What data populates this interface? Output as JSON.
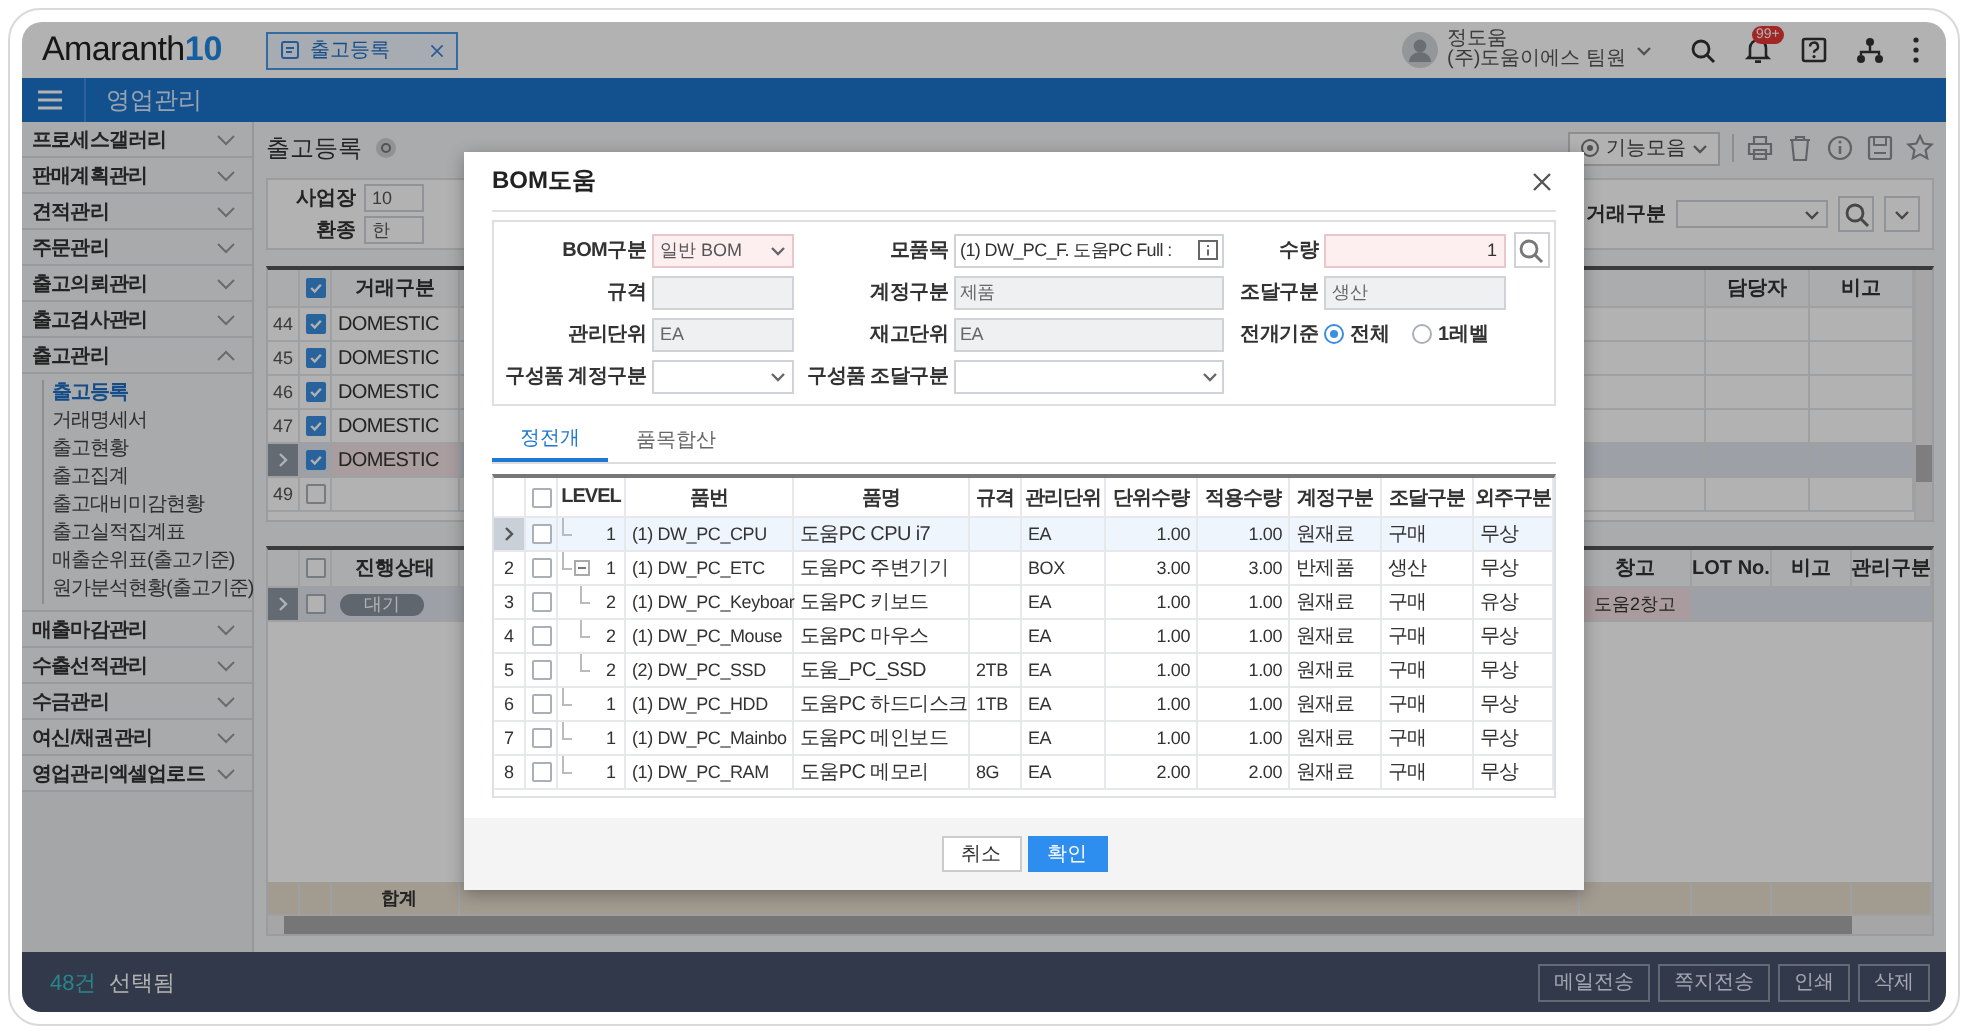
{
  "header": {
    "logo": "Amaranth",
    "logo_version": "10",
    "open_tab": {
      "label": "출고등록",
      "selected": true
    },
    "user": {
      "name": "정도움",
      "org": "(주)도움이에스 팀원"
    },
    "notification_badge": "99+"
  },
  "menu_bar": {
    "title": "영업관리"
  },
  "sidebar": {
    "items": [
      {
        "label": "프로세스갤러리",
        "expanded": false
      },
      {
        "label": "판매계획관리",
        "expanded": false
      },
      {
        "label": "견적관리",
        "expanded": false
      },
      {
        "label": "주문관리",
        "expanded": false
      },
      {
        "label": "출고의뢰관리",
        "expanded": false
      },
      {
        "label": "출고검사관리",
        "expanded": false
      },
      {
        "label": "출고관리",
        "expanded": true,
        "children": [
          {
            "label": "출고등록",
            "selected": true
          },
          {
            "label": "거래명세서",
            "selected": false
          },
          {
            "label": "출고현황",
            "selected": false
          },
          {
            "label": "출고집계",
            "selected": false
          },
          {
            "label": "출고대비미감현황",
            "selected": false
          },
          {
            "label": "출고실적집계표",
            "selected": false
          },
          {
            "label": "매출순위표(출고기준)",
            "selected": false
          },
          {
            "label": "원가분석현황(출고기준)",
            "selected": false
          }
        ]
      },
      {
        "label": "매출마감관리",
        "expanded": false
      },
      {
        "label": "수출선적관리",
        "expanded": false
      },
      {
        "label": "수금관리",
        "expanded": false
      },
      {
        "label": "여신/채권관리",
        "expanded": false
      },
      {
        "label": "영업관리엑셀업로드",
        "expanded": false
      }
    ]
  },
  "page": {
    "title": "출고등록",
    "toolbar_button": "기능모음",
    "search": {
      "fields": [
        {
          "label": "사업장",
          "value": "10"
        },
        {
          "label": "환종",
          "value": "한"
        }
      ],
      "right_field": {
        "label": "거래구분"
      }
    },
    "upper_grid": {
      "header_checked": true,
      "left_columns": [
        "거래구분"
      ],
      "right_columns": [
        "담당자",
        "비고"
      ],
      "rows": [
        {
          "no": "44",
          "checked": true,
          "selected": false,
          "type": "DOMESTIC"
        },
        {
          "no": "45",
          "checked": true,
          "selected": false,
          "type": "DOMESTIC"
        },
        {
          "no": "46",
          "checked": true,
          "selected": false,
          "type": "DOMESTIC"
        },
        {
          "no": "47",
          "checked": true,
          "selected": false,
          "type": "DOMESTIC"
        },
        {
          "checked": true,
          "selected": true,
          "type": "DOMESTIC"
        },
        {
          "no": "49",
          "checked": false,
          "selected": false
        }
      ]
    },
    "lower_grid": {
      "header_checked": false,
      "left_columns": [
        "진행상태"
      ],
      "right_columns": [
        "창고",
        "LOT No.",
        "비고",
        "관리구분"
      ],
      "rows": [
        {
          "checked": false,
          "selected": true,
          "status": "대기",
          "warehouse": "도움2창고"
        }
      ],
      "total_label": "합계"
    }
  },
  "status_bar": {
    "count": "48건",
    "count_label": "선택됨",
    "buttons": [
      "메일전송",
      "쪽지전송",
      "인쇄",
      "삭제"
    ]
  },
  "modal": {
    "title": "BOM도움",
    "form": [
      {
        "kind": "select",
        "label": "BOM구분",
        "value": "일반 BOM",
        "required": true,
        "disabled": false
      },
      {
        "kind": "lookup",
        "label": "모품목",
        "value": "(1) DW_PC_F. 도움PC Full :",
        "required": false,
        "disabled": false
      },
      {
        "kind": "number",
        "label": "수량",
        "value": "1",
        "required": true,
        "disabled": false
      },
      {
        "kind": "text",
        "label": "규격",
        "required": false,
        "disabled": true
      },
      {
        "kind": "text",
        "label": "계정구분",
        "value": "제품",
        "required": false,
        "disabled": true
      },
      {
        "kind": "text",
        "label": "조달구분",
        "value": "생산",
        "required": false,
        "disabled": true
      },
      {
        "kind": "text",
        "label": "관리단위",
        "value": "EA",
        "required": false,
        "disabled": true
      },
      {
        "kind": "text",
        "label": "재고단위",
        "value": "EA",
        "required": false,
        "disabled": true
      },
      {
        "kind": "radio",
        "label": "전개기준",
        "options": [
          {
            "label": "전체",
            "selected": true
          },
          {
            "label": "1레벨",
            "selected": false
          }
        ]
      },
      {
        "kind": "select",
        "label": "구성품 계정구분",
        "required": false,
        "disabled": false
      },
      {
        "kind": "select",
        "label": "구성품 조달구분",
        "required": false,
        "disabled": false
      }
    ],
    "tabs": [
      {
        "label": "정전개",
        "selected": true
      },
      {
        "label": "품목합산",
        "selected": false
      }
    ],
    "table": {
      "header_checked": false,
      "columns": [
        "LEVEL",
        "품번",
        "품명",
        "규격",
        "관리단위",
        "단위수량",
        "적용수량",
        "계정구분",
        "조달구분",
        "외주구분"
      ],
      "rows": [
        {
          "selected": true,
          "checked": false,
          "level_no": "1",
          "item_code": "(1) DW_PC_CPU",
          "item_name": "도움PC CPU i7",
          "unit": "EA",
          "unit_qty": "1.00",
          "applied_qty": "1.00",
          "account": "원재료",
          "procurement": "구매",
          "outsourcing": "무상"
        },
        {
          "no": "2",
          "selected": false,
          "checked": false,
          "expanded": true,
          "level_no": "1",
          "item_code": "(1) DW_PC_ETC",
          "item_name": "도움PC 주변기기",
          "unit": "BOX",
          "unit_qty": "3.00",
          "applied_qty": "3.00",
          "account": "반제품",
          "procurement": "생산",
          "outsourcing": "무상",
          "children": [
            {
              "no": "3",
              "selected": false,
              "checked": false,
              "level_no": "2",
              "item_code": "(1) DW_PC_Keyboar",
              "item_name": "도움PC 키보드",
              "unit": "EA",
              "unit_qty": "1.00",
              "applied_qty": "1.00",
              "account": "원재료",
              "procurement": "구매",
              "outsourcing": "유상"
            },
            {
              "no": "4",
              "selected": false,
              "checked": false,
              "level_no": "2",
              "item_code": "(1) DW_PC_Mouse",
              "item_name": "도움PC 마우스",
              "unit": "EA",
              "unit_qty": "1.00",
              "applied_qty": "1.00",
              "account": "원재료",
              "procurement": "구매",
              "outsourcing": "무상"
            },
            {
              "no": "5",
              "selected": false,
              "checked": false,
              "level_no": "2",
              "item_code": "(2) DW_PC_SSD",
              "item_name": "도움_PC_SSD",
              "spec": "2TB",
              "unit": "EA",
              "unit_qty": "1.00",
              "applied_qty": "1.00",
              "account": "원재료",
              "procurement": "구매",
              "outsourcing": "무상"
            }
          ]
        },
        {
          "no": "6",
          "selected": false,
          "checked": false,
          "level_no": "1",
          "item_code": "(1) DW_PC_HDD",
          "item_name": "도움PC 하드디스크",
          "spec": "1TB",
          "unit": "EA",
          "unit_qty": "1.00",
          "applied_qty": "1.00",
          "account": "원재료",
          "procurement": "구매",
          "outsourcing": "무상"
        },
        {
          "no": "7",
          "selected": false,
          "checked": false,
          "level_no": "1",
          "item_code": "(1) DW_PC_Mainbo",
          "item_name": "도움PC 메인보드",
          "unit": "EA",
          "unit_qty": "1.00",
          "applied_qty": "1.00",
          "account": "원재료",
          "procurement": "구매",
          "outsourcing": "무상"
        },
        {
          "no": "8",
          "selected": false,
          "checked": false,
          "level_no": "1",
          "item_code": "(1) DW_PC_RAM",
          "item_name": "도움PC 메모리",
          "spec": "8G",
          "unit": "EA",
          "unit_qty": "2.00",
          "applied_qty": "2.00",
          "account": "원재료",
          "procurement": "구매",
          "outsourcing": "무상"
        }
      ]
    },
    "buttons": [
      {
        "label": "취소",
        "kind": "secondary"
      },
      {
        "label": "확인",
        "kind": "primary"
      }
    ]
  }
}
